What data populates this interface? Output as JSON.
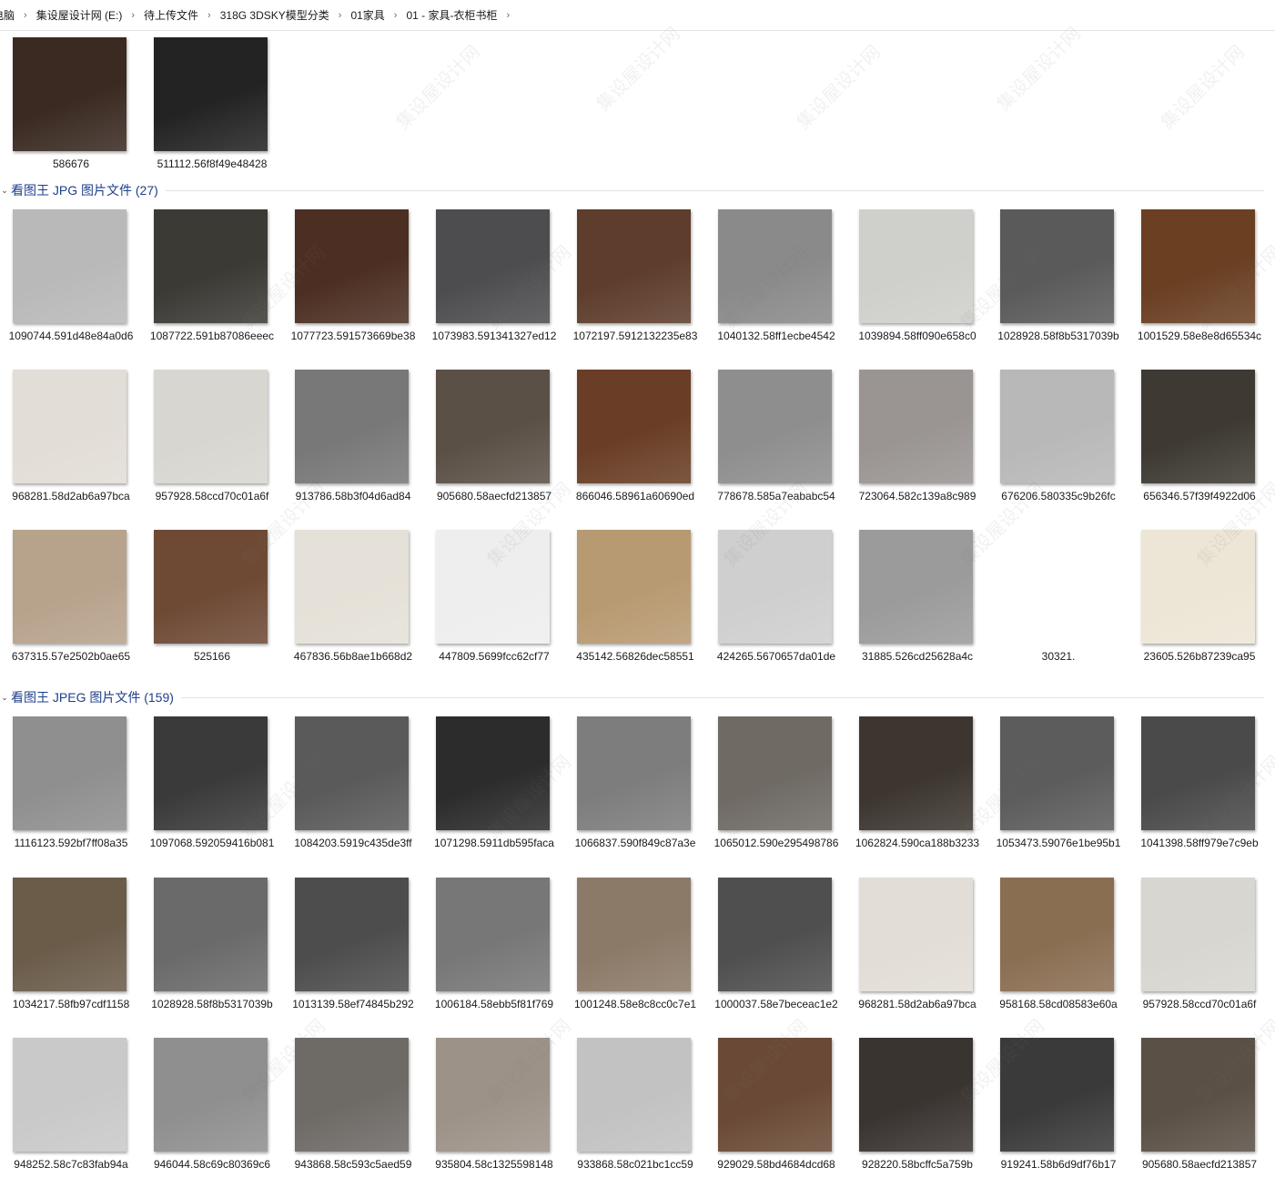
{
  "breadcrumb": [
    "电脑",
    "集设屋设计网 (E:)",
    "待上传文件",
    "318G 3DSKY模型分类",
    "01家具",
    "01 - 家具-衣柜书柜"
  ],
  "breadcrumb_separator": "›",
  "top_files": [
    {
      "name": "586676",
      "color": "#3a2a22"
    },
    {
      "name": "511112.56f8f49e48428",
      "color": "#232323"
    }
  ],
  "groups": [
    {
      "title": "看图王 JPG 图片文件 (27)",
      "files": [
        {
          "name": "1090744.591d48e84a0d6",
          "color": "#b9b9b9"
        },
        {
          "name": "1087722.591b87086eeec",
          "color": "#3b3a35"
        },
        {
          "name": "1077723.591573669be38",
          "color": "#4c2f22"
        },
        {
          "name": "1073983.591341327ed12",
          "color": "#4d4d4f"
        },
        {
          "name": "1072197.5912132235e83",
          "color": "#5e3d2c"
        },
        {
          "name": "1040132.58ff1ecbe4542",
          "color": "#8a8a8a"
        },
        {
          "name": "1039894.58ff090e658c0",
          "color": "#cfcfcb"
        },
        {
          "name": "1028928.58f8b5317039b",
          "color": "#5a5a5a"
        },
        {
          "name": "1001529.58e8e8d65534c",
          "color": "#6a3f22"
        },
        {
          "name": "968281.58d2ab6a97bca",
          "color": "#e2ddd6"
        },
        {
          "name": "957928.58ccd70c01a6f",
          "color": "#d8d6d0"
        },
        {
          "name": "913786.58b3f04d6ad84",
          "color": "#787878"
        },
        {
          "name": "905680.58aecfd213857",
          "color": "#5b5046"
        },
        {
          "name": "866046.58961a60690ed",
          "color": "#6a3e26"
        },
        {
          "name": "778678.585a7eababc54",
          "color": "#8e8e8e"
        },
        {
          "name": "723064.582c139a8c989",
          "color": "#9a9593"
        },
        {
          "name": "676206.580335c9b26fc",
          "color": "#b8b8b8"
        },
        {
          "name": "656346.57f39f4922d06",
          "color": "#3e3a33"
        },
        {
          "name": "637315.57e2502b0ae65",
          "color": "#b7a28c"
        },
        {
          "name": "525166",
          "color": "#6e4a35"
        },
        {
          "name": "467836.56b8ae1b668d2",
          "color": "#e5e1d8"
        },
        {
          "name": "447809.5699fcc62cf77",
          "color": "#eeeeee"
        },
        {
          "name": "435142.56826dec58551",
          "color": "#b89a72"
        },
        {
          "name": "424265.5670657da01de",
          "color": "#cfcfcf"
        },
        {
          "name": "31885.526cd25628a4c",
          "color": "#9b9b9b"
        },
        {
          "name": "30321.",
          "color": "#ffffff"
        },
        {
          "name": "23605.526b87239ca95",
          "color": "#ede6d6"
        }
      ]
    },
    {
      "title": "看图王 JPEG 图片文件 (159)",
      "files": [
        {
          "name": "1116123.592bf7ff08a35",
          "color": "#8f8f8f"
        },
        {
          "name": "1097068.592059416b081",
          "color": "#3a3a3a"
        },
        {
          "name": "1084203.5919c435de3ff",
          "color": "#5a5a5a"
        },
        {
          "name": "1071298.5911db595faca",
          "color": "#2c2c2c"
        },
        {
          "name": "1066837.590f849c87a3e",
          "color": "#7d7d7d"
        },
        {
          "name": "1065012.590e295498786",
          "color": "#6f6a64"
        },
        {
          "name": "1062824.590ca188b3233",
          "color": "#3d3630"
        },
        {
          "name": "1053473.59076e1be95b1",
          "color": "#5c5c5c"
        },
        {
          "name": "1041398.58ff979e7c9eb",
          "color": "#4a4a4a"
        },
        {
          "name": "1034217.58fb97cdf1158",
          "color": "#6b5c4a"
        },
        {
          "name": "1028928.58f8b5317039b",
          "color": "#6a6a6a"
        },
        {
          "name": "1013139.58ef74845b292",
          "color": "#4d4d4d"
        },
        {
          "name": "1006184.58ebb5f81f769",
          "color": "#777777"
        },
        {
          "name": "1001248.58e8c8cc0c7e1",
          "color": "#8c7a68"
        },
        {
          "name": "1000037.58e7beceac1e2",
          "color": "#4f4f4f"
        },
        {
          "name": "968281.58d2ab6a97bca",
          "color": "#e2ddd6"
        },
        {
          "name": "958168.58cd08583e60a",
          "color": "#8a6e52"
        },
        {
          "name": "957928.58ccd70c01a6f",
          "color": "#d8d6d0"
        },
        {
          "name": "948252.58c7c83fab94a",
          "color": "#c9c9c9"
        },
        {
          "name": "946044.58c69c80369c6",
          "color": "#8f8f8f"
        },
        {
          "name": "943868.58c593c5aed59",
          "color": "#6e6a66"
        },
        {
          "name": "935804.58c1325598148",
          "color": "#9c9288"
        },
        {
          "name": "933868.58c021bc1cc59",
          "color": "#c2c2c2"
        },
        {
          "name": "929029.58bd4684dcd68",
          "color": "#6a4a36"
        },
        {
          "name": "928220.58bcffc5a759b",
          "color": "#3a3431"
        },
        {
          "name": "919241.58b6d9df76b17",
          "color": "#3a3a3a"
        },
        {
          "name": "905680.58aecfd213857",
          "color": "#5b5046"
        }
      ]
    }
  ],
  "watermark": "集设屋设计网"
}
